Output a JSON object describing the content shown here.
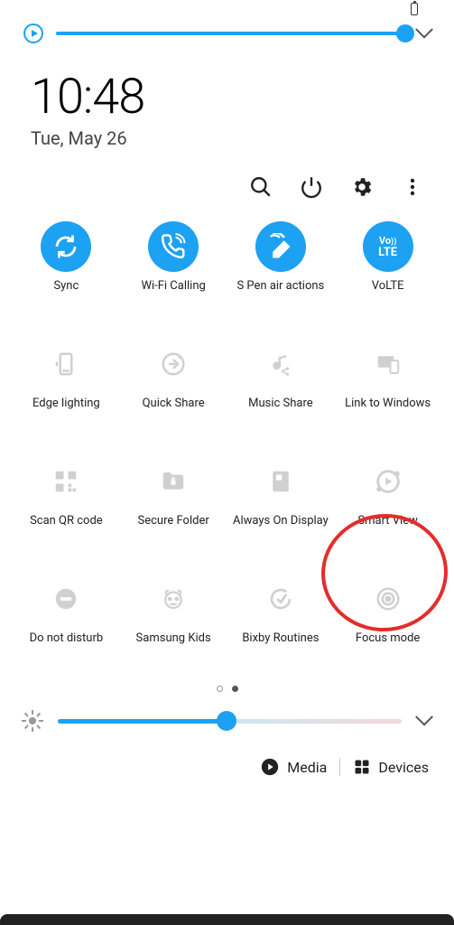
{
  "status": {
    "battery_icon": "battery-icon"
  },
  "media_slider": {
    "position_percent": 100
  },
  "clock": {
    "time": "10:48",
    "date": "Tue, May 26"
  },
  "util": {
    "search": "search-icon",
    "power": "power-icon",
    "settings": "gear-icon",
    "more": "more-icon"
  },
  "tiles": [
    {
      "label": "Sync",
      "icon": "sync-icon",
      "active": true
    },
    {
      "label": "Wi-Fi Calling",
      "icon": "wifi-calling-icon",
      "active": true
    },
    {
      "label": "S Pen air actions",
      "icon": "s-pen-air-icon",
      "active": true
    },
    {
      "label": "VoLTE",
      "icon": "volte-icon",
      "active": true
    },
    {
      "label": "Edge lighting",
      "icon": "edge-lighting-icon",
      "active": false
    },
    {
      "label": "Quick Share",
      "icon": "quick-share-icon",
      "active": false
    },
    {
      "label": "Music Share",
      "icon": "music-share-icon",
      "active": false
    },
    {
      "label": "Link to Windows",
      "icon": "link-windows-icon",
      "active": false
    },
    {
      "label": "Scan QR code",
      "icon": "qr-icon",
      "active": false
    },
    {
      "label": "Secure Folder",
      "icon": "secure-folder-icon",
      "active": false
    },
    {
      "label": "Always On Display",
      "icon": "aod-icon",
      "active": false
    },
    {
      "label": "Smart View",
      "icon": "smart-view-icon",
      "active": false
    },
    {
      "label": "Do not disturb",
      "icon": "dnd-icon",
      "active": false
    },
    {
      "label": "Samsung Kids",
      "icon": "samsung-kids-icon",
      "active": false
    },
    {
      "label": "Bixby Routines",
      "icon": "bixby-routines-icon",
      "active": false
    },
    {
      "label": "Focus mode",
      "icon": "focus-mode-icon",
      "active": false
    }
  ],
  "pagination": {
    "total": 2,
    "current": 2
  },
  "brightness": {
    "position_percent": 49
  },
  "bottom": {
    "media_label": "Media",
    "devices_label": "Devices"
  },
  "annotation": {
    "highlighted_tile": "Smart View",
    "style": "red-circle"
  },
  "colors": {
    "accent": "#1DA1F2",
    "inactive": "#bbbbbb",
    "text": "#222222",
    "annotation": "#e42c2c"
  }
}
